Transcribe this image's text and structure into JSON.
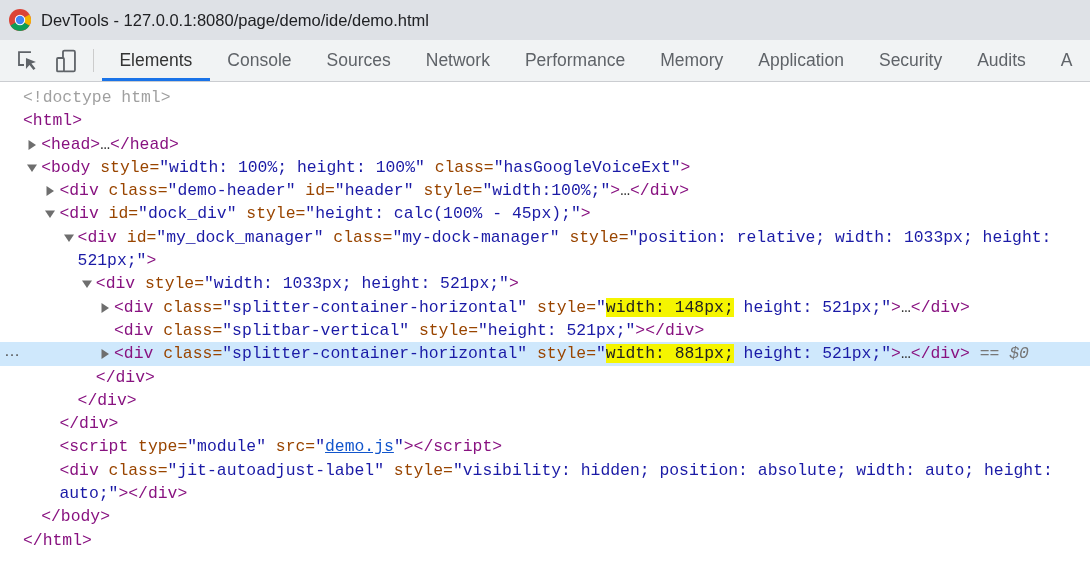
{
  "window": {
    "title": "DevTools - 127.0.0.1:8080/page/demo/ide/demo.html"
  },
  "tabs": [
    {
      "label": "Elements",
      "selected": true
    },
    {
      "label": "Console",
      "selected": false
    },
    {
      "label": "Sources",
      "selected": false
    },
    {
      "label": "Network",
      "selected": false
    },
    {
      "label": "Performance",
      "selected": false
    },
    {
      "label": "Memory",
      "selected": false
    },
    {
      "label": "Application",
      "selected": false
    },
    {
      "label": "Security",
      "selected": false
    },
    {
      "label": "Audits",
      "selected": false
    },
    {
      "label": "A",
      "selected": false
    }
  ],
  "dom_tree": [
    {
      "selected": false,
      "lines": [
        [
          {
            "kind": "doctype",
            "text": "<!doctype html>"
          }
        ]
      ]
    },
    {
      "selected": false,
      "lines": [
        [
          {
            "kind": "tag",
            "text": "<html>"
          }
        ]
      ],
      "close": [
        {
          "kind": "tag",
          "text": "</html>"
        }
      ],
      "children": [
        {
          "selected": false,
          "expanded": false,
          "lines": [
            [
              {
                "kind": "tag",
                "text": "<head>"
              },
              {
                "kind": "punct",
                "text": "…"
              },
              {
                "kind": "tag",
                "text": "</head>"
              }
            ]
          ]
        },
        {
          "selected": false,
          "expanded": true,
          "lines": [
            [
              {
                "kind": "tag",
                "text": "<body"
              },
              {
                "kind": "attr",
                "text": " style="
              },
              {
                "kind": "val",
                "text": "\"width: 100%; height: 100%\""
              },
              {
                "kind": "attr",
                "text": " class="
              },
              {
                "kind": "val",
                "text": "\"hasGoogleVoiceExt\""
              },
              {
                "kind": "tag",
                "text": ">"
              }
            ]
          ],
          "close": [
            {
              "kind": "tag",
              "text": "</body>"
            }
          ],
          "children": [
            {
              "selected": false,
              "expanded": false,
              "lines": [
                [
                  {
                    "kind": "tag",
                    "text": "<div"
                  },
                  {
                    "kind": "attr",
                    "text": " class="
                  },
                  {
                    "kind": "val",
                    "text": "\"demo-header\""
                  },
                  {
                    "kind": "attr",
                    "text": " id="
                  },
                  {
                    "kind": "val",
                    "text": "\"header\""
                  },
                  {
                    "kind": "attr",
                    "text": " style="
                  },
                  {
                    "kind": "val",
                    "text": "\"width:100%;\""
                  },
                  {
                    "kind": "tag",
                    "text": ">"
                  },
                  {
                    "kind": "punct",
                    "text": "…"
                  },
                  {
                    "kind": "tag",
                    "text": "</div>"
                  }
                ]
              ]
            },
            {
              "selected": false,
              "expanded": true,
              "lines": [
                [
                  {
                    "kind": "tag",
                    "text": "<div"
                  },
                  {
                    "kind": "attr",
                    "text": " id="
                  },
                  {
                    "kind": "val",
                    "text": "\"dock_div\""
                  },
                  {
                    "kind": "attr",
                    "text": " style="
                  },
                  {
                    "kind": "val",
                    "text": "\"height: calc(100% - 45px);\""
                  },
                  {
                    "kind": "tag",
                    "text": ">"
                  }
                ]
              ],
              "close": [
                {
                  "kind": "tag",
                  "text": "</div>"
                }
              ],
              "children": [
                {
                  "selected": false,
                  "expanded": true,
                  "lines": [
                    [
                      {
                        "kind": "tag",
                        "text": "<div"
                      },
                      {
                        "kind": "attr",
                        "text": " id="
                      },
                      {
                        "kind": "val",
                        "text": "\"my_dock_manager\""
                      },
                      {
                        "kind": "attr",
                        "text": " class="
                      },
                      {
                        "kind": "val",
                        "text": "\"my-dock-manager\""
                      },
                      {
                        "kind": "attr",
                        "text": " style="
                      },
                      {
                        "kind": "val",
                        "text": "\"position: relative; width: 1033px; height:"
                      }
                    ],
                    [
                      {
                        "kind": "val",
                        "text": "521px;\""
                      },
                      {
                        "kind": "tag",
                        "text": ">"
                      }
                    ]
                  ],
                  "close": [
                    {
                      "kind": "tag",
                      "text": "</div>"
                    }
                  ],
                  "children": [
                    {
                      "selected": false,
                      "expanded": true,
                      "lines": [
                        [
                          {
                            "kind": "tag",
                            "text": "<div"
                          },
                          {
                            "kind": "attr",
                            "text": " style="
                          },
                          {
                            "kind": "val",
                            "text": "\"width: 1033px; height: 521px;\""
                          },
                          {
                            "kind": "tag",
                            "text": ">"
                          }
                        ]
                      ],
                      "close": [
                        {
                          "kind": "tag",
                          "text": "</div>"
                        }
                      ],
                      "children": [
                        {
                          "selected": false,
                          "expanded": false,
                          "lines": [
                            [
                              {
                                "kind": "tag",
                                "text": "<div"
                              },
                              {
                                "kind": "attr",
                                "text": " class="
                              },
                              {
                                "kind": "val",
                                "text": "\"splitter-container-horizontal\""
                              },
                              {
                                "kind": "attr",
                                "text": " style="
                              },
                              {
                                "kind": "val",
                                "text": "\""
                              },
                              {
                                "kind": "marked",
                                "text": "width: 148px;"
                              },
                              {
                                "kind": "val",
                                "text": " height: 521px;\""
                              },
                              {
                                "kind": "tag",
                                "text": ">"
                              },
                              {
                                "kind": "punct",
                                "text": "…"
                              },
                              {
                                "kind": "tag",
                                "text": "</div>"
                              }
                            ]
                          ]
                        },
                        {
                          "selected": false,
                          "lines": [
                            [
                              {
                                "kind": "tag",
                                "text": "<div"
                              },
                              {
                                "kind": "attr",
                                "text": " class="
                              },
                              {
                                "kind": "val",
                                "text": "\"splitbar-vertical\""
                              },
                              {
                                "kind": "attr",
                                "text": " style="
                              },
                              {
                                "kind": "val",
                                "text": "\"height: 521px;\""
                              },
                              {
                                "kind": "tag",
                                "text": ">"
                              },
                              {
                                "kind": "tag",
                                "text": "</div>"
                              }
                            ]
                          ]
                        },
                        {
                          "selected": true,
                          "expanded": false,
                          "gutter": "…",
                          "lines": [
                            [
                              {
                                "kind": "tag",
                                "text": "<div"
                              },
                              {
                                "kind": "attr",
                                "text": " class="
                              },
                              {
                                "kind": "val",
                                "text": "\"splitter-container-horizontal\""
                              },
                              {
                                "kind": "attr",
                                "text": " style="
                              },
                              {
                                "kind": "val",
                                "text": "\""
                              },
                              {
                                "kind": "marked",
                                "text": "width: 881px;"
                              },
                              {
                                "kind": "val",
                                "text": " height: 521px;\""
                              },
                              {
                                "kind": "tag",
                                "text": ">"
                              },
                              {
                                "kind": "punct",
                                "text": "…"
                              },
                              {
                                "kind": "tag",
                                "text": "</div>"
                              },
                              {
                                "kind": "ref",
                                "text": " == $0"
                              }
                            ]
                          ]
                        }
                      ]
                    }
                  ]
                }
              ]
            },
            {
              "selected": false,
              "lines": [
                [
                  {
                    "kind": "tag",
                    "text": "<script"
                  },
                  {
                    "kind": "attr",
                    "text": " type="
                  },
                  {
                    "kind": "val",
                    "text": "\"module\""
                  },
                  {
                    "kind": "attr",
                    "text": " src="
                  },
                  {
                    "kind": "val",
                    "text": "\""
                  },
                  {
                    "kind": "link",
                    "text": "demo.js"
                  },
                  {
                    "kind": "val",
                    "text": "\""
                  },
                  {
                    "kind": "tag",
                    "text": ">"
                  },
                  {
                    "kind": "tag",
                    "text": "</script>"
                  }
                ]
              ]
            },
            {
              "selected": false,
              "lines": [
                [
                  {
                    "kind": "tag",
                    "text": "<div"
                  },
                  {
                    "kind": "attr",
                    "text": " class="
                  },
                  {
                    "kind": "val",
                    "text": "\"jit-autoadjust-label\""
                  },
                  {
                    "kind": "attr",
                    "text": " style="
                  },
                  {
                    "kind": "val",
                    "text": "\"visibility: hidden; position: absolute; width: auto; height:"
                  }
                ],
                [
                  {
                    "kind": "val",
                    "text": "auto;\""
                  },
                  {
                    "kind": "tag",
                    "text": ">"
                  },
                  {
                    "kind": "tag",
                    "text": "</div>"
                  }
                ]
              ]
            }
          ]
        }
      ]
    }
  ]
}
